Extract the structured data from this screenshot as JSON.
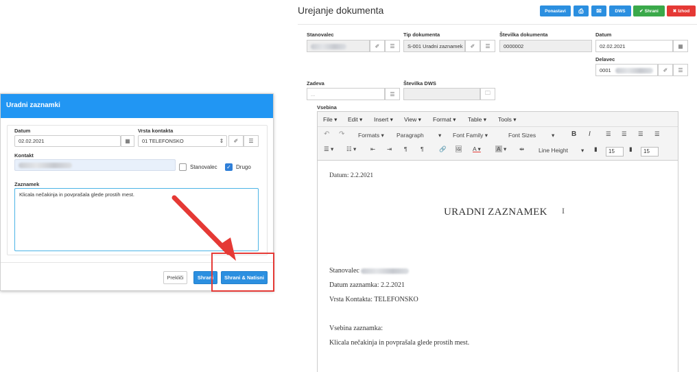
{
  "dialog": {
    "title": "Uradni zaznamki",
    "datum_label": "Datum",
    "datum_value": "02.02.2021",
    "vrsta_label": "Vrsta kontakta",
    "vrsta_value": "01 TELEFONSKO",
    "kontakt_label": "Kontakt",
    "stanovalec_label": "Stanovalec",
    "drugo_label": "Drugo",
    "zaznamek_label": "Zaznamek",
    "zaznamek_value": "Klicala nečakinja in povpraša​la glede prostih mest.",
    "cancel_label": "Prekliči",
    "save_label": "Shrani",
    "save_new_label": "Shrani & Natisni"
  },
  "page": {
    "title": "Urejanje dokumenta",
    "buttons": {
      "ponastavi": "Ponastavi",
      "dws": "DWS",
      "shrani": "Shrani",
      "izhod": "Izhod"
    },
    "fields": {
      "stanovalec_label": "Stanovalec",
      "tip_label": "Tip dokumenta",
      "tip_value": "S-001 Uradni zaznamek",
      "stevilka_label": "Številka dokumenta",
      "stevilka_value": "0000002",
      "datum_label": "Datum",
      "datum_value": "02.02.2021",
      "delavec_label": "Delavec",
      "delavec_value": "0001",
      "zadeva_label": "Zadeva",
      "zadeva_placeholder": "...",
      "dws_label": "Številka DWS",
      "vsebina_label": "Vsebina"
    }
  },
  "editor": {
    "menu": [
      "File",
      "Edit",
      "Insert",
      "View",
      "Format",
      "Table",
      "Tools"
    ],
    "formats": "Formats",
    "paragraph": "Paragraph",
    "font_family": "Font Family",
    "font_sizes": "Font Sizes",
    "line_height": "Line Height",
    "num1": "15",
    "num2": "15",
    "content": {
      "datum": "Datum: 2.2.2021",
      "title": "URADNI ZAZNAMEK",
      "stanovalec": "Stanovalec",
      "datum_zaznamka": "Datum zaznamka: 2.2.2021",
      "vrsta": "Vrsta Kontakta: TELEFONSKO",
      "vsebina_label": "Vsebina zaznamka:",
      "vsebina_text": "Klicala nečakinja in povpraša​la glede prostih mest."
    }
  },
  "colors": {
    "primary": "#2196f3",
    "success": "#3aa94a",
    "danger": "#e53935",
    "callout": "#e53935"
  }
}
